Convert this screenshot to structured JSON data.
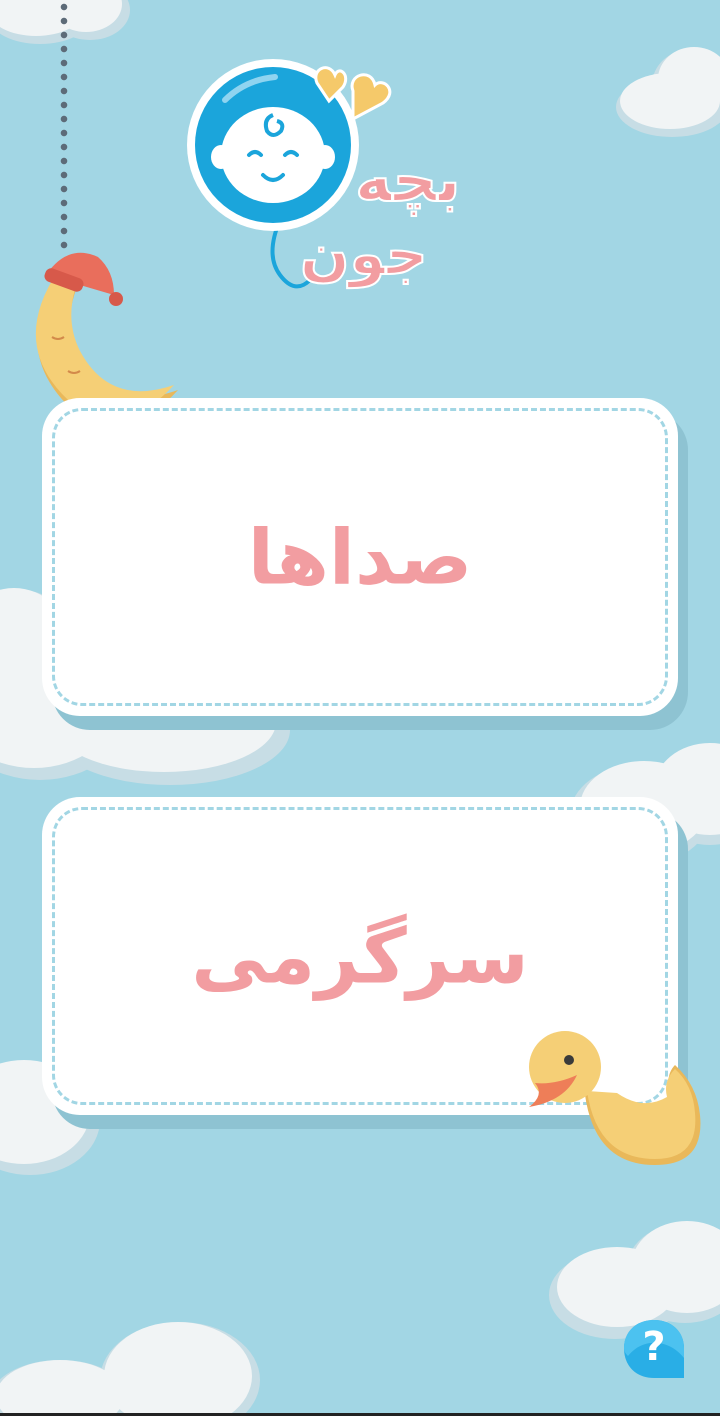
{
  "logo": {
    "word_top": "بچه",
    "word_bottom": "جون",
    "icon": "baby-balloon-icon"
  },
  "menu": {
    "sounds_label": "صداها",
    "fun_label": "سرگرمی"
  },
  "help": {
    "label": "?",
    "icon": "help-bubble-icon"
  },
  "decor": {
    "moon": "sleeping-moon-icon",
    "duck": "rubber-duck-icon"
  },
  "colors": {
    "background": "#a2d6e4",
    "accent_pink": "#f29da1",
    "balloon_blue": "#1ba5db",
    "yellow": "#f5c96a"
  }
}
